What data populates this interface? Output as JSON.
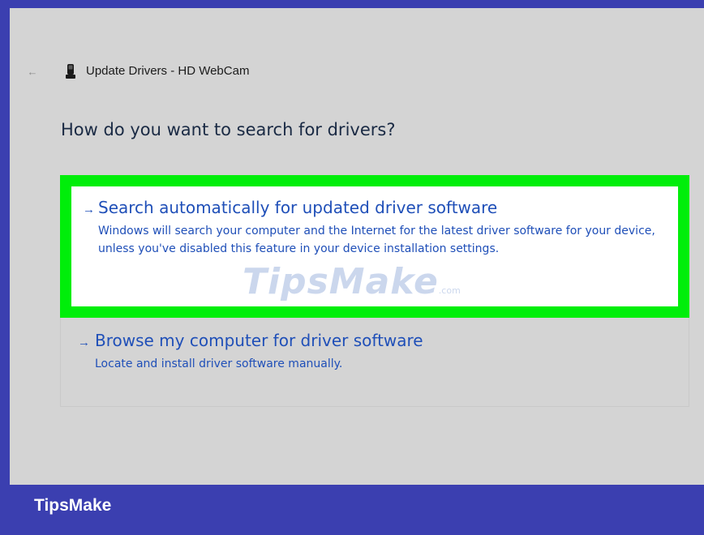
{
  "window": {
    "title": "Update Drivers - HD WebCam",
    "back_glyph": "←"
  },
  "prompt": {
    "question": "How do you want to search for drivers?"
  },
  "options": [
    {
      "arrow": "→",
      "title": "Search automatically for updated driver software",
      "description": "Windows will search your computer and the Internet for the latest driver software for your device, unless you've disabled this feature in your device installation settings.",
      "highlighted": true
    },
    {
      "arrow": "→",
      "title": "Browse my computer for driver software",
      "description": "Locate and install driver software manually.",
      "highlighted": false
    }
  ],
  "watermark": {
    "text": "TipsMake",
    "suffix": ".com"
  },
  "footer": {
    "brand": "TipsMake"
  },
  "colors": {
    "link_blue": "#1f4fb8",
    "highlight_green": "#00ee0a",
    "frame_blue": "#3b3fb0",
    "window_gray": "#d4d4d4"
  },
  "icons": {
    "back": "back-arrow-icon",
    "device": "webcam-icon"
  }
}
